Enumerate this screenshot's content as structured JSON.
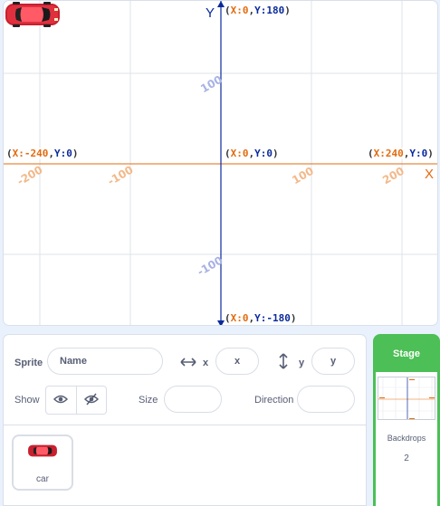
{
  "stage": {
    "y_axis_label": "Y",
    "x_axis_label": "X",
    "x_ticks": [
      "-200",
      "-100",
      "100",
      "200"
    ],
    "y_ticks": [
      "100",
      "-100"
    ],
    "coord_labels": {
      "top": {
        "x": "0",
        "y": "180"
      },
      "bottom": {
        "x": "0",
        "y": "-180"
      },
      "left": {
        "x": "-240",
        "y": "0"
      },
      "right": {
        "x": "240",
        "y": "0"
      },
      "center": {
        "x": "0",
        "y": "0"
      }
    },
    "colors": {
      "x_axis": "#e36b0e",
      "y_axis": "#0a2a9c",
      "grid": "#dfe3ea",
      "car_body": "#e0303e"
    }
  },
  "sprite_info": {
    "sprite_label": "Sprite",
    "name_placeholder": "Name",
    "x_label": "x",
    "x_placeholder": "x",
    "y_label": "y",
    "y_placeholder": "y",
    "show_label": "Show",
    "size_label": "Size",
    "direction_label": "Direction"
  },
  "sprite_list": {
    "sprites": [
      {
        "name": "car",
        "icon": "car-icon"
      }
    ]
  },
  "stage_selector": {
    "title": "Stage",
    "backdrops_label": "Backdrops",
    "backdrops_count": "2",
    "accent": "#4cbf56"
  }
}
